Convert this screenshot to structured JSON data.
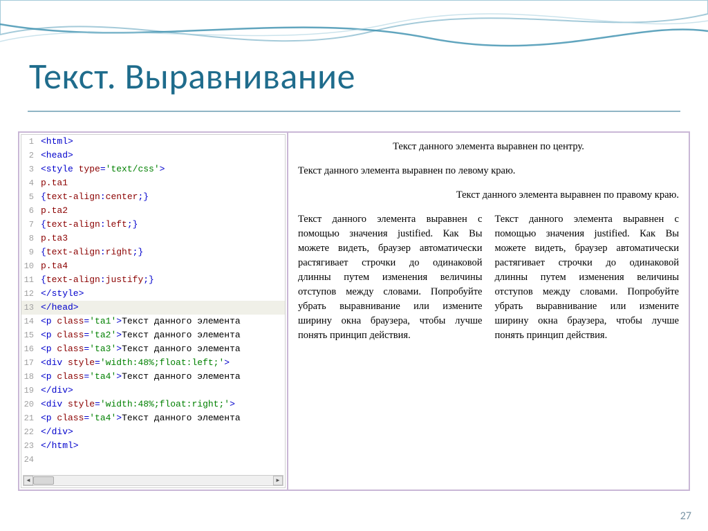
{
  "slide": {
    "title": "Текст. Выравнивание",
    "page_number": "27"
  },
  "code": {
    "lines": [
      {
        "n": "1",
        "segments": [
          {
            "cls": "tag",
            "t": "<html>"
          }
        ]
      },
      {
        "n": "2",
        "segments": [
          {
            "cls": "tag",
            "t": "<head>"
          }
        ]
      },
      {
        "n": "3",
        "segments": [
          {
            "cls": "tag",
            "t": "<style "
          },
          {
            "cls": "prop",
            "t": "type"
          },
          {
            "cls": "tag",
            "t": "="
          },
          {
            "cls": "attr-str",
            "t": "'text/css'"
          },
          {
            "cls": "tag",
            "t": ">"
          }
        ]
      },
      {
        "n": "4",
        "segments": [
          {
            "cls": "prop",
            "t": "p.ta1"
          }
        ]
      },
      {
        "n": "5",
        "segments": [
          {
            "cls": "tag",
            "t": "{"
          },
          {
            "cls": "prop",
            "t": "text-align"
          },
          {
            "cls": "tag",
            "t": ":"
          },
          {
            "cls": "prop",
            "t": "center"
          },
          {
            "cls": "tag",
            "t": ";}"
          }
        ]
      },
      {
        "n": "6",
        "segments": [
          {
            "cls": "prop",
            "t": "p.ta2"
          }
        ]
      },
      {
        "n": "7",
        "segments": [
          {
            "cls": "tag",
            "t": "{"
          },
          {
            "cls": "prop",
            "t": "text-align"
          },
          {
            "cls": "tag",
            "t": ":"
          },
          {
            "cls": "prop",
            "t": "left"
          },
          {
            "cls": "tag",
            "t": ";}"
          }
        ]
      },
      {
        "n": "8",
        "segments": [
          {
            "cls": "prop",
            "t": "p.ta3"
          }
        ]
      },
      {
        "n": "9",
        "segments": [
          {
            "cls": "tag",
            "t": "{"
          },
          {
            "cls": "prop",
            "t": "text-align"
          },
          {
            "cls": "tag",
            "t": ":"
          },
          {
            "cls": "prop",
            "t": "right"
          },
          {
            "cls": "tag",
            "t": ";}"
          }
        ]
      },
      {
        "n": "10",
        "segments": [
          {
            "cls": "prop",
            "t": "p.ta4"
          }
        ]
      },
      {
        "n": "11",
        "segments": [
          {
            "cls": "tag",
            "t": "{"
          },
          {
            "cls": "prop",
            "t": "text-align"
          },
          {
            "cls": "tag",
            "t": ":"
          },
          {
            "cls": "prop",
            "t": "justify"
          },
          {
            "cls": "tag",
            "t": ";}"
          }
        ]
      },
      {
        "n": "12",
        "segments": [
          {
            "cls": "tag",
            "t": "</style>"
          }
        ]
      },
      {
        "n": "13",
        "hl": true,
        "segments": [
          {
            "cls": "tag",
            "t": "</head>"
          }
        ]
      },
      {
        "n": "14",
        "segments": [
          {
            "cls": "tag",
            "t": "<p "
          },
          {
            "cls": "prop",
            "t": "class"
          },
          {
            "cls": "tag",
            "t": "="
          },
          {
            "cls": "attr-str",
            "t": "'ta1'"
          },
          {
            "cls": "tag",
            "t": ">"
          },
          {
            "cls": "plain",
            "t": "Текст данного элемента"
          }
        ]
      },
      {
        "n": "15",
        "segments": [
          {
            "cls": "tag",
            "t": "<p "
          },
          {
            "cls": "prop",
            "t": "class"
          },
          {
            "cls": "tag",
            "t": "="
          },
          {
            "cls": "attr-str",
            "t": "'ta2'"
          },
          {
            "cls": "tag",
            "t": ">"
          },
          {
            "cls": "plain",
            "t": "Текст данного элемента"
          }
        ]
      },
      {
        "n": "16",
        "segments": [
          {
            "cls": "tag",
            "t": "<p "
          },
          {
            "cls": "prop",
            "t": "class"
          },
          {
            "cls": "tag",
            "t": "="
          },
          {
            "cls": "attr-str",
            "t": "'ta3'"
          },
          {
            "cls": "tag",
            "t": ">"
          },
          {
            "cls": "plain",
            "t": "Текст данного элемента"
          }
        ]
      },
      {
        "n": "17",
        "segments": [
          {
            "cls": "tag",
            "t": "<div "
          },
          {
            "cls": "prop",
            "t": "style"
          },
          {
            "cls": "tag",
            "t": "="
          },
          {
            "cls": "attr-str",
            "t": "'width:48%;float:left;'"
          },
          {
            "cls": "tag",
            "t": ">"
          }
        ]
      },
      {
        "n": "18",
        "segments": [
          {
            "cls": "tag",
            "t": "<p "
          },
          {
            "cls": "prop",
            "t": "class"
          },
          {
            "cls": "tag",
            "t": "="
          },
          {
            "cls": "attr-str",
            "t": "'ta4'"
          },
          {
            "cls": "tag",
            "t": ">"
          },
          {
            "cls": "plain",
            "t": "Текст данного элемента"
          }
        ]
      },
      {
        "n": "19",
        "segments": [
          {
            "cls": "tag",
            "t": "</div>"
          }
        ]
      },
      {
        "n": "20",
        "segments": [
          {
            "cls": "tag",
            "t": "<div "
          },
          {
            "cls": "prop",
            "t": "style"
          },
          {
            "cls": "tag",
            "t": "="
          },
          {
            "cls": "attr-str",
            "t": "'width:48%;float:right;'"
          },
          {
            "cls": "tag",
            "t": ">"
          }
        ]
      },
      {
        "n": "21",
        "segments": [
          {
            "cls": "tag",
            "t": "<p "
          },
          {
            "cls": "prop",
            "t": "class"
          },
          {
            "cls": "tag",
            "t": "="
          },
          {
            "cls": "attr-str",
            "t": "'ta4'"
          },
          {
            "cls": "tag",
            "t": ">"
          },
          {
            "cls": "plain",
            "t": "Текст данного элемента"
          }
        ]
      },
      {
        "n": "22",
        "segments": [
          {
            "cls": "tag",
            "t": "</div>"
          }
        ]
      },
      {
        "n": "23",
        "segments": [
          {
            "cls": "tag",
            "t": "</html>"
          }
        ]
      },
      {
        "n": "24",
        "segments": []
      }
    ]
  },
  "render": {
    "center": "Текст данного элемента выравнен по центру.",
    "left": "Текст данного элемента выравнен по левому краю.",
    "right": "Текст данного элемента выравнен по правому краю.",
    "justify": "Текст данного элемента выравнен с помощью значения justified. Как Вы можете видеть, браузер автоматически растягивает строчки до одинаковой длинны путем изменения величины отступов между словами. Попробуйте убрать выравнивание или измените ширину окна браузера, чтобы лучше понять принцип действия."
  }
}
